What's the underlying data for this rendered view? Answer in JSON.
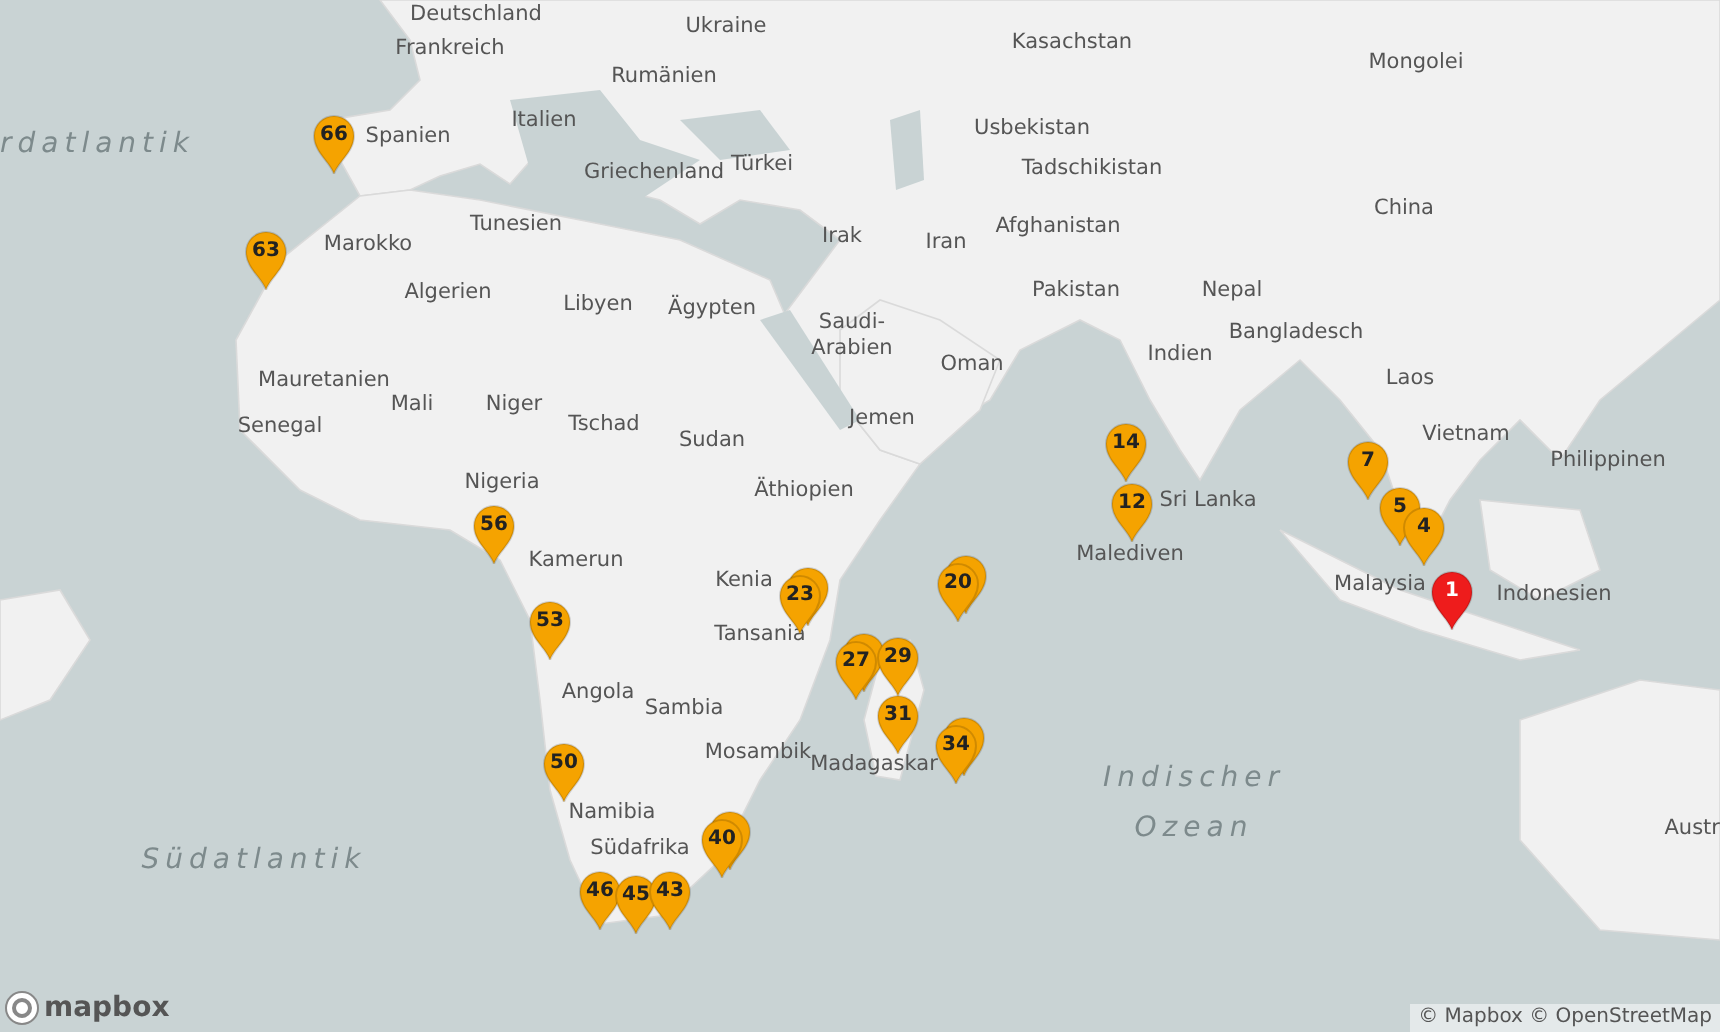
{
  "map": {
    "labels": [
      {
        "text": "Deutschland",
        "kind": "country"
      },
      {
        "text": "Frankreich",
        "kind": "country"
      },
      {
        "text": "Ukraine",
        "kind": "country"
      },
      {
        "text": "Kasachstan",
        "kind": "country"
      },
      {
        "text": "Mongolei",
        "kind": "country"
      },
      {
        "text": "Spanien",
        "kind": "country"
      },
      {
        "text": "Italien",
        "kind": "country"
      },
      {
        "text": "Rumänien",
        "kind": "country"
      },
      {
        "text": "Usbekistan",
        "kind": "country"
      },
      {
        "text": "Griechenland",
        "kind": "country"
      },
      {
        "text": "Türkei",
        "kind": "country"
      },
      {
        "text": "Tadschikistan",
        "kind": "country"
      },
      {
        "text": "China",
        "kind": "country"
      },
      {
        "text": "Tunesien",
        "kind": "country"
      },
      {
        "text": "Irak",
        "kind": "country"
      },
      {
        "text": "Iran",
        "kind": "country"
      },
      {
        "text": "Afghanistan",
        "kind": "country"
      },
      {
        "text": "Marokko",
        "kind": "country"
      },
      {
        "text": "Algerien",
        "kind": "country"
      },
      {
        "text": "Libyen",
        "kind": "country"
      },
      {
        "text": "Ägypten",
        "kind": "country"
      },
      {
        "text": "Pakistan",
        "kind": "country"
      },
      {
        "text": "Nepal",
        "kind": "country"
      },
      {
        "text": "Saudi-",
        "kind": "country"
      },
      {
        "text": "Arabien",
        "kind": "country"
      },
      {
        "text": "Indien",
        "kind": "country"
      },
      {
        "text": "Bangladesch",
        "kind": "country"
      },
      {
        "text": "Oman",
        "kind": "country"
      },
      {
        "text": "Laos",
        "kind": "country"
      },
      {
        "text": "Mauretanien",
        "kind": "country"
      },
      {
        "text": "Senegal",
        "kind": "country"
      },
      {
        "text": "Mali",
        "kind": "country"
      },
      {
        "text": "Niger",
        "kind": "country"
      },
      {
        "text": "Tschad",
        "kind": "country"
      },
      {
        "text": "Sudan",
        "kind": "country"
      },
      {
        "text": "Jemen",
        "kind": "country"
      },
      {
        "text": "Vietnam",
        "kind": "country"
      },
      {
        "text": "Philippinen",
        "kind": "country"
      },
      {
        "text": "Nigeria",
        "kind": "country"
      },
      {
        "text": "Äthiopien",
        "kind": "country"
      },
      {
        "text": "Sri Lanka",
        "kind": "country"
      },
      {
        "text": "Malediven",
        "kind": "country"
      },
      {
        "text": "Kamerun",
        "kind": "country"
      },
      {
        "text": "Kenia",
        "kind": "country"
      },
      {
        "text": "Malaysia",
        "kind": "country"
      },
      {
        "text": "Indonesien",
        "kind": "country"
      },
      {
        "text": "Tansania",
        "kind": "country"
      },
      {
        "text": "Angola",
        "kind": "country"
      },
      {
        "text": "Sambia",
        "kind": "country"
      },
      {
        "text": "Mosambik",
        "kind": "country"
      },
      {
        "text": "Madagaskar",
        "kind": "country"
      },
      {
        "text": "Namibia",
        "kind": "country"
      },
      {
        "text": "Südafrika",
        "kind": "country"
      },
      {
        "text": "rdatlantik",
        "kind": "ocean"
      },
      {
        "text": "Südatlantik",
        "kind": "ocean"
      },
      {
        "text": "Indischer",
        "kind": "ocean"
      },
      {
        "text": "Ozean",
        "kind": "ocean"
      },
      {
        "text": "Austr",
        "kind": "country"
      }
    ],
    "markers": [
      {
        "label": "66",
        "color": "#f5a300",
        "stacked": false
      },
      {
        "label": "63",
        "color": "#f5a300",
        "stacked": false
      },
      {
        "label": "56",
        "color": "#f5a300",
        "stacked": false
      },
      {
        "label": "53",
        "color": "#f5a300",
        "stacked": false
      },
      {
        "label": "50",
        "color": "#f5a300",
        "stacked": false
      },
      {
        "label": "46",
        "color": "#f5a300",
        "stacked": false
      },
      {
        "label": "45",
        "color": "#f5a300",
        "stacked": false
      },
      {
        "label": "43",
        "color": "#f5a300",
        "stacked": false
      },
      {
        "label": "40",
        "color": "#f5a300",
        "stacked": true
      },
      {
        "label": "23",
        "color": "#f5a300",
        "stacked": true
      },
      {
        "label": "20",
        "color": "#f5a300",
        "stacked": true
      },
      {
        "label": "27",
        "color": "#f5a300",
        "stacked": true
      },
      {
        "label": "29",
        "color": "#f5a300",
        "stacked": false
      },
      {
        "label": "31",
        "color": "#f5a300",
        "stacked": false
      },
      {
        "label": "34",
        "color": "#f5a300",
        "stacked": true
      },
      {
        "label": "14",
        "color": "#f5a300",
        "stacked": false
      },
      {
        "label": "12",
        "color": "#f5a300",
        "stacked": false
      },
      {
        "label": "7",
        "color": "#f5a300",
        "stacked": false
      },
      {
        "label": "5",
        "color": "#f5a300",
        "stacked": false
      },
      {
        "label": "4",
        "color": "#f5a300",
        "stacked": false
      },
      {
        "label": "1",
        "color": "#ee1c1c",
        "stacked": false
      }
    ]
  },
  "logo": {
    "text": "mapbox"
  },
  "attribution": "© Mapbox © OpenStreetMap"
}
